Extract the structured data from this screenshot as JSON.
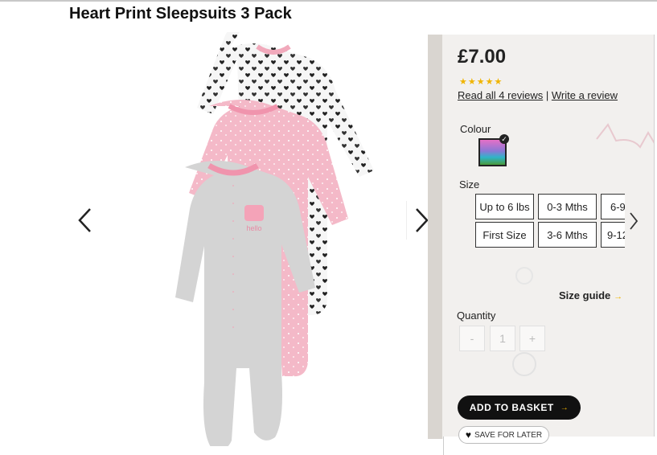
{
  "product": {
    "title": "Heart Print Sleepsuits 3 Pack",
    "price": "£7.00",
    "rating": 5,
    "stars": "★★★★★",
    "read_reviews": "Read all 4 reviews",
    "review_separator": "|",
    "write_review": "Write a review"
  },
  "colour": {
    "label": "Colour"
  },
  "size": {
    "label": "Size",
    "options_row1": [
      "Up to 6 lbs",
      "0-3 Mths",
      "6-9"
    ],
    "options_row2": [
      "First Size",
      "3-6 Mths",
      "9-12"
    ],
    "guide_label": "Size guide"
  },
  "quantity": {
    "label": "Quantity",
    "minus": "-",
    "value": "1",
    "plus": "+"
  },
  "actions": {
    "add_to_basket": "ADD TO BASKET",
    "save_for_later": "SAVE FOR LATER"
  },
  "icons": {
    "prev": "chevron-left-icon",
    "next": "chevron-right-icon",
    "size_next": "chevron-right-icon",
    "arrow": "arrow-right-icon",
    "heart": "heart-icon",
    "check": "check-icon"
  }
}
